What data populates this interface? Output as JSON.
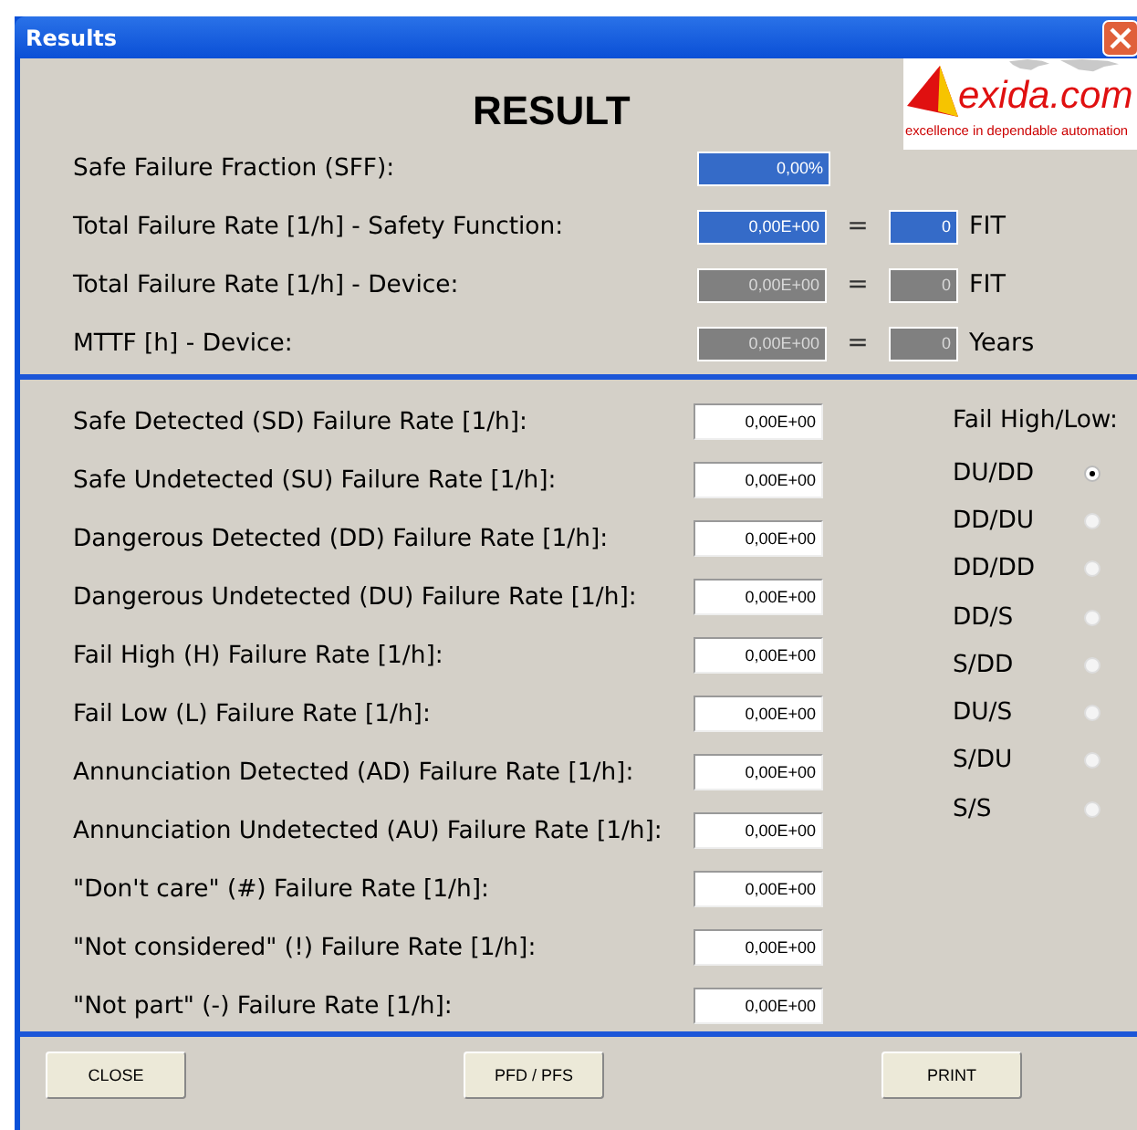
{
  "window": {
    "title": "Results"
  },
  "heading": "RESULT",
  "logo": {
    "name": "exida.com",
    "tagline": "excellence in dependable automation"
  },
  "summary": [
    {
      "label": "Safe Failure Fraction (SFF):",
      "value": "0,00%",
      "disabled": false
    },
    {
      "label": "Total Failure Rate [1/h] - Safety Function:",
      "value": "0,00E+00",
      "disabled": false,
      "equals": "=",
      "value_2": "0",
      "unit": "FIT"
    },
    {
      "label": "Total Failure Rate [1/h] - Device:",
      "value": "0,00E+00",
      "disabled": true,
      "equals": "=",
      "value_2": "0",
      "unit": "FIT"
    },
    {
      "label": "MTTF [h] - Device:",
      "value": "0,00E+00",
      "disabled": true,
      "equals": "=",
      "value_2": "0",
      "unit": "Years"
    }
  ],
  "rates": [
    {
      "label": "Safe Detected (SD) Failure Rate [1/h]:",
      "value": "0,00E+00"
    },
    {
      "label": "Safe Undetected (SU) Failure Rate [1/h]:",
      "value": "0,00E+00"
    },
    {
      "label": "Dangerous Detected (DD) Failure Rate [1/h]:",
      "value": "0,00E+00"
    },
    {
      "label": "Dangerous Undetected (DU) Failure Rate [1/h]:",
      "value": "0,00E+00"
    },
    {
      "label": "Fail High (H) Failure Rate [1/h]:",
      "value": "0,00E+00"
    },
    {
      "label": "Fail Low (L) Failure Rate [1/h]:",
      "value": "0,00E+00"
    },
    {
      "label": "Annunciation Detected (AD) Failure Rate [1/h]:",
      "value": "0,00E+00"
    },
    {
      "label": "Annunciation Undetected (AU) Failure Rate [1/h]:",
      "value": "0,00E+00"
    },
    {
      "label": "\"Don't care\" (#) Failure Rate [1/h]:",
      "value": "0,00E+00"
    },
    {
      "label": "\"Not considered\" (!) Failure Rate [1/h]:",
      "value": "0,00E+00"
    },
    {
      "label": "\"Not part\" (-) Failure Rate [1/h]:",
      "value": "0,00E+00"
    }
  ],
  "fail_high_low": {
    "title": "Fail High/Low:",
    "options": [
      {
        "label": "DU/DD",
        "selected": true
      },
      {
        "label": "DD/DU",
        "selected": false
      },
      {
        "label": "DD/DD",
        "selected": false
      },
      {
        "label": "DD/S",
        "selected": false
      },
      {
        "label": "S/DD",
        "selected": false
      },
      {
        "label": "DU/S",
        "selected": false
      },
      {
        "label": "S/DU",
        "selected": false
      },
      {
        "label": "S/S",
        "selected": false
      }
    ]
  },
  "buttons": [
    "CLOSE",
    "PFD / PFS",
    "PRINT"
  ]
}
